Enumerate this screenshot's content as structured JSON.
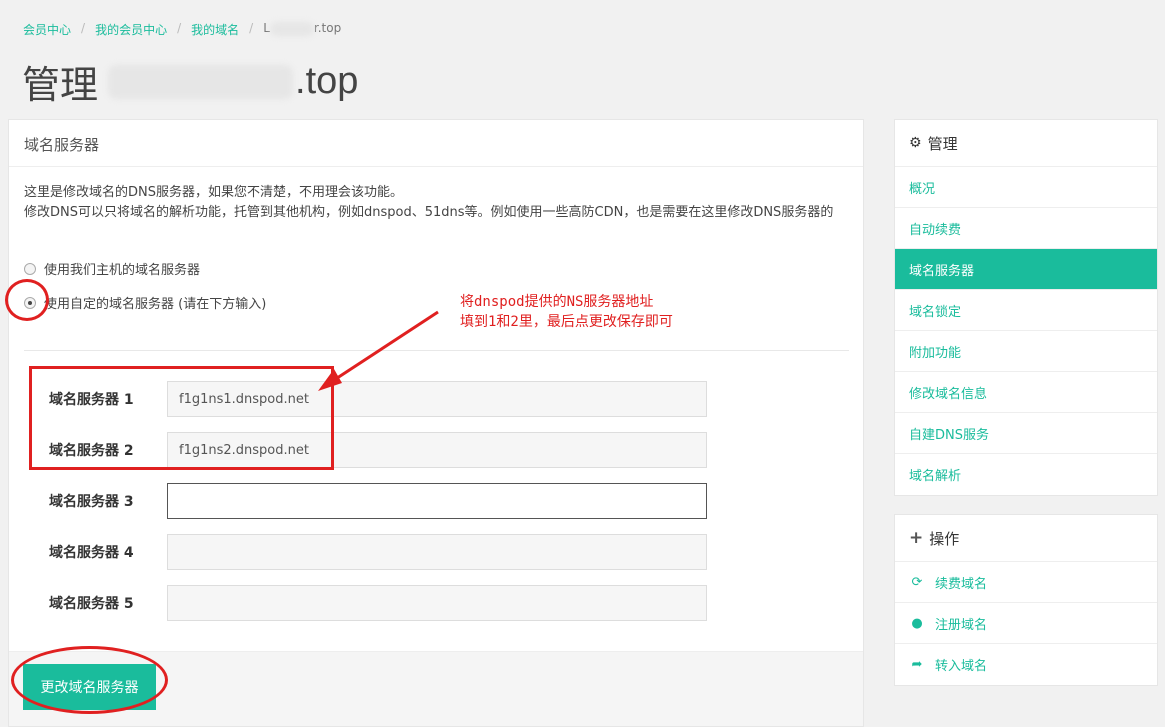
{
  "breadcrumb": {
    "items": [
      "会员中心",
      "我的会员中心",
      "我的域名"
    ],
    "current_suffix": "r.top",
    "current_prefix": "L"
  },
  "page_title": {
    "prefix": "管理",
    "suffix": ".top"
  },
  "main_panel": {
    "heading": "域名服务器",
    "desc_line1": "这里是修改域名的DNS服务器，如果您不清楚，不用理会该功能。",
    "desc_line2": "修改DNS可以只将域名的解析功能，托管到其他机构，例如dnspod、51dns等。例如使用一些高防CDN，也是需要在这里修改DNS服务器的",
    "radio_default": "使用我们主机的域名服务器",
    "radio_custom": "使用自定的域名服务器 (请在下方输入)",
    "nameservers": [
      {
        "label": "域名服务器 1",
        "value": "f1g1ns1.dnspod.net"
      },
      {
        "label": "域名服务器 2",
        "value": "f1g1ns2.dnspod.net"
      },
      {
        "label": "域名服务器 3",
        "value": ""
      },
      {
        "label": "域名服务器 4",
        "value": ""
      },
      {
        "label": "域名服务器 5",
        "value": ""
      }
    ],
    "submit_label": "更改域名服务器"
  },
  "annotation": {
    "line1": "将dnspod提供的NS服务器地址",
    "line2": "填到1和2里，最后点更改保存即可"
  },
  "sidebar_manage": {
    "title": "管理",
    "items": [
      "概况",
      "自动续费",
      "域名服务器",
      "域名锁定",
      "附加功能",
      "修改域名信息",
      "自建DNS服务",
      "域名解析"
    ],
    "active_index": 2
  },
  "sidebar_actions": {
    "title": "操作",
    "items": [
      {
        "icon": "refresh-icon",
        "label": "续费域名"
      },
      {
        "icon": "globe-icon",
        "label": "注册域名"
      },
      {
        "icon": "share-arrow-icon",
        "label": "转入域名"
      }
    ]
  },
  "colors": {
    "accent": "#1abc9c",
    "annotation": "#e02020"
  }
}
